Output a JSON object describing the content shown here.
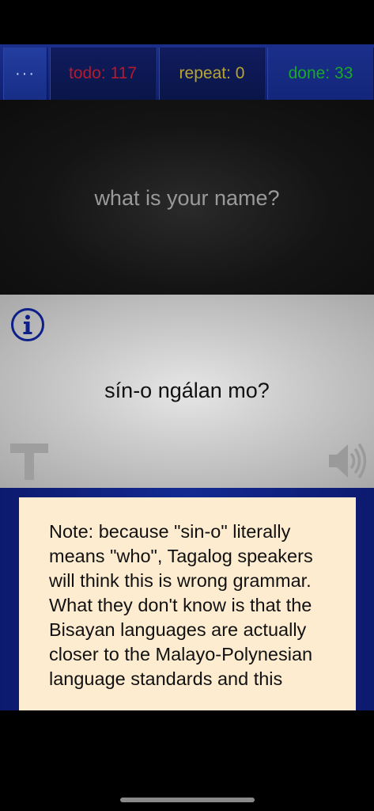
{
  "tabs": {
    "menu_label": "···",
    "todo_label": "todo: 117",
    "repeat_label": "repeat: 0",
    "done_label": "done: 33"
  },
  "question": {
    "text": "what is your name?"
  },
  "answer": {
    "text": "sín-o ngálan mo?"
  },
  "note": {
    "text": "Note: because \"sin-o\" literally means \"who\", Tagalog speakers will think this is wrong grammar. What they don't know is that the Bisayan languages are actually closer to the Malayo-Polynesian language standards and this"
  },
  "colors": {
    "tabbar": "#1b2f8a",
    "todo": "#b31b2e",
    "repeat": "#b9a532",
    "done": "#1aa82a",
    "note_bg": "#fdecd0"
  },
  "icons": [
    "info-icon",
    "text-t-icon",
    "speaker-icon"
  ]
}
